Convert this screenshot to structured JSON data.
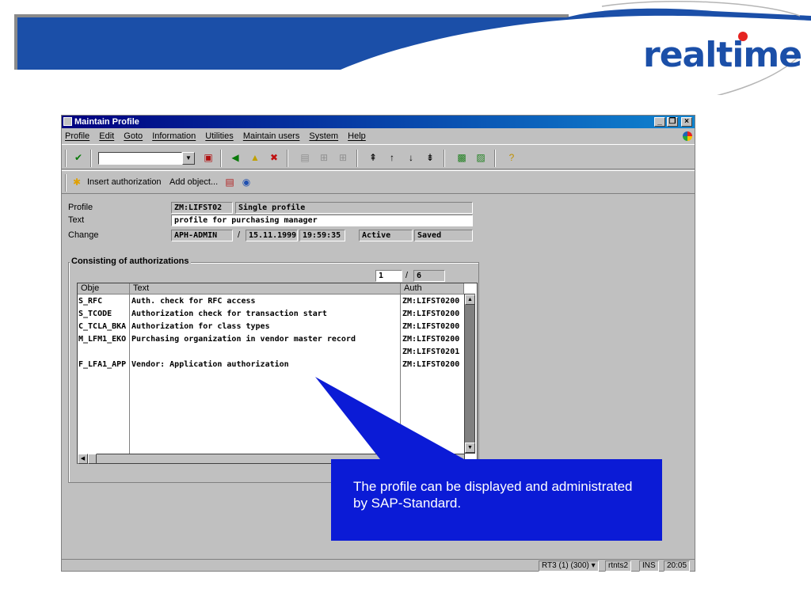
{
  "brand": {
    "logo_text": "realtime",
    "colors": {
      "header_blue": "#1b4fa8",
      "callout_blue": "#0b1bd6",
      "sap_gray": "#c0c0c0"
    }
  },
  "window": {
    "title": "Maintain Profile",
    "controls": {
      "minimize": "_",
      "maximize": "❐",
      "close": "×"
    }
  },
  "menu": [
    "Profile",
    "Edit",
    "Goto",
    "Information",
    "Utilities",
    "Maintain users",
    "System",
    "Help"
  ],
  "toolbar": {
    "icons": [
      "enter-icon",
      "save-icon",
      "back-icon",
      "exit-icon",
      "cancel-icon",
      "print-icon",
      "find-icon",
      "find-next-icon",
      "first-page-icon",
      "prev-page-icon",
      "next-page-icon",
      "last-page-icon",
      "new-session-icon",
      "shortcut-icon",
      "help-icon"
    ]
  },
  "app_toolbar": {
    "insert_authorization": "Insert authorization",
    "add_object": "Add object..."
  },
  "fields": {
    "profile_label": "Profile",
    "profile_value": "ZM:LIFST02",
    "profile_type": "Single profile",
    "text_label": "Text",
    "text_value": "profile for purchasing manager",
    "change_label": "Change",
    "change_user": "APH-ADMIN",
    "change_sep": "/",
    "change_date": "15.11.1999",
    "change_time": "19:59:35",
    "change_status1": "Active",
    "change_status2": "Saved"
  },
  "authorizations": {
    "group_title": "Consisting of authorizations",
    "page_current": "1",
    "page_sep": "/",
    "page_total": "6",
    "headers": {
      "object": "Obje",
      "text": "Text",
      "auth": "Auth"
    },
    "rows": [
      {
        "object": "S_RFC",
        "text": "Auth. check for RFC access",
        "auth": "ZM:LIFST0200"
      },
      {
        "object": "S_TCODE",
        "text": "Authorization check for transaction start",
        "auth": "ZM:LIFST0200"
      },
      {
        "object": "C_TCLA_BKA",
        "text": "Authorization for class types",
        "auth": "ZM:LIFST0200"
      },
      {
        "object": "M_LFM1_EKO",
        "text": "Purchasing organization in vendor master record",
        "auth": "ZM:LIFST0200"
      },
      {
        "object": "",
        "text": "",
        "auth": "ZM:LIFST0201"
      },
      {
        "object": "F_LFA1_APP",
        "text": "Vendor: Application authorization",
        "auth": "ZM:LIFST0200"
      }
    ]
  },
  "statusbar": {
    "system": "RT3 (1) (300) ▾",
    "server": "rtnts2",
    "mode": "INS",
    "time": "20:05"
  },
  "callout": {
    "text": "The profile can be displayed and administrated by SAP-Standard."
  }
}
